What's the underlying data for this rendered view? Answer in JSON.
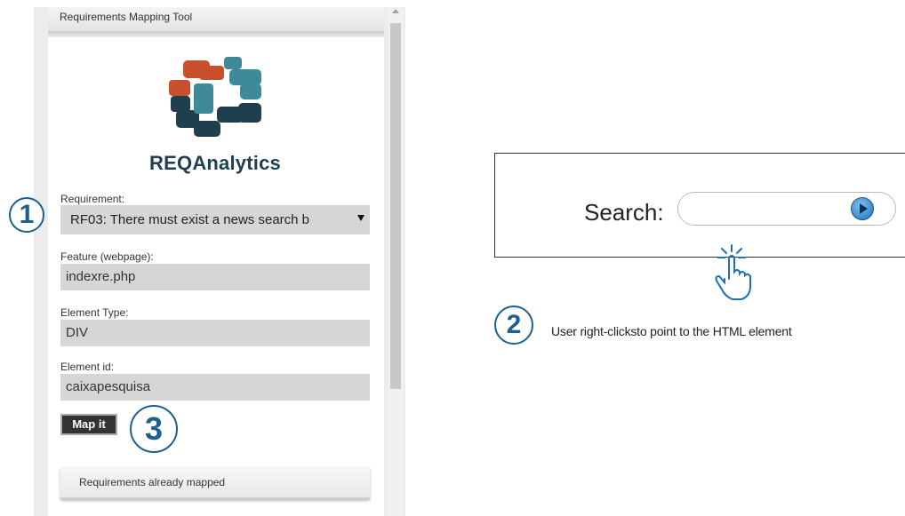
{
  "panel": {
    "title": "Requirements Mapping Tool",
    "brand": "REQAnalytics",
    "requirement": {
      "label": "Requirement:",
      "selected": "RF03: There must exist a news search b"
    },
    "feature": {
      "label": "Feature (webpage):",
      "value": "indexre.php"
    },
    "element_type": {
      "label": "Element Type:",
      "value": "DIV"
    },
    "element_id": {
      "label": "Element id:",
      "value": "caixapesquisa"
    },
    "map_button": "Map it",
    "mapped_section": "Requirements already mapped"
  },
  "badges": {
    "one": "1",
    "two": "2",
    "three": "3"
  },
  "demo": {
    "search_label": "Search:",
    "caption": "User right-clicksto point to the HTML element"
  },
  "colors": {
    "accent": "#1e5f8c",
    "logo_orange": "#c9502c",
    "logo_dark": "#1f3f4e",
    "logo_teal": "#3f8a99"
  },
  "icons": [
    "logo-icon",
    "dropdown-arrow-icon",
    "play-icon",
    "pointing-hand-icon",
    "scroll-up-icon"
  ]
}
